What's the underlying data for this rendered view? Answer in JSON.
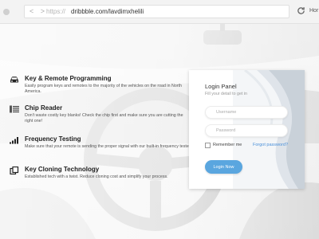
{
  "browser": {
    "nav_arrows": "< >",
    "url_scheme": "https://",
    "url_host": "dribbble.com/lavdimxhelili",
    "home_label": "Hor"
  },
  "features": [
    {
      "icon": "car-icon",
      "title": "Key & Remote Programming",
      "description": "Easily program keys and remotes to the majority of the vehicles on the road in North America."
    },
    {
      "icon": "chip-icon",
      "title": "Chip Reader",
      "description": "Don't waste costly key blanks! Check the chip first and make sure you are cutting the right one!"
    },
    {
      "icon": "signal-bars-icon",
      "title": "Frequency Testing",
      "description": "Make sure that your remote is sending the proper signal with our built-in frequency tester."
    },
    {
      "icon": "copy-icon",
      "title": "Key Cloning Technology",
      "description": "Established tech with a twist. Reduce cloning cost and simplify your process."
    }
  ],
  "login": {
    "title": "Login Panel",
    "subtitle": "Fill your detail to get in",
    "username_placeholder": "Username",
    "password_placeholder": "Password",
    "remember_label": "Remember me",
    "forgot_label": "Forgot password?",
    "button_label": "Login Now"
  },
  "colors": {
    "accent": "#5aa6df",
    "link": "#4a90d9",
    "text_dark": "#1e1e1e"
  }
}
